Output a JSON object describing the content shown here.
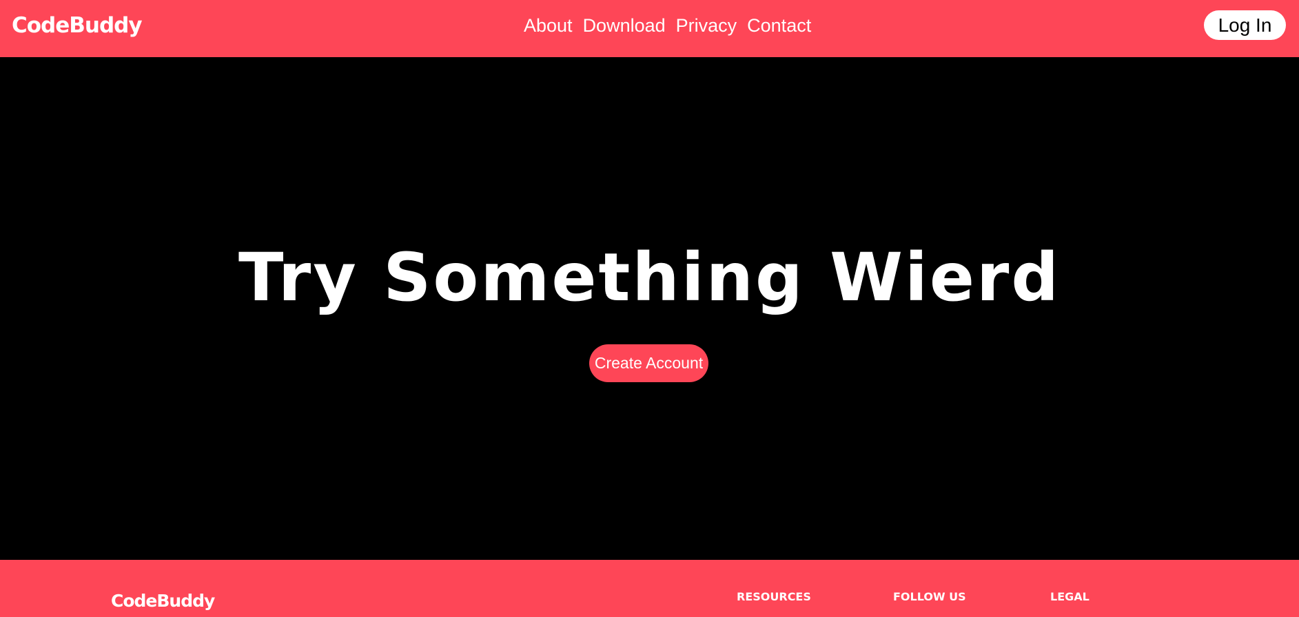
{
  "header": {
    "brand": "CodeBuddy",
    "nav": [
      {
        "label": "About"
      },
      {
        "label": "Download"
      },
      {
        "label": "Privacy"
      },
      {
        "label": "Contact"
      }
    ],
    "login_label": "Log In"
  },
  "hero": {
    "title": "Try Something Wierd",
    "cta_label": "Create Account"
  },
  "footer": {
    "brand": "CodeBuddy",
    "headings": [
      "RESOURCES",
      "FOLLOW US",
      "LEGAL"
    ]
  },
  "colors": {
    "accent": "#fe4657",
    "background": "#000000",
    "text": "#ffffff"
  }
}
